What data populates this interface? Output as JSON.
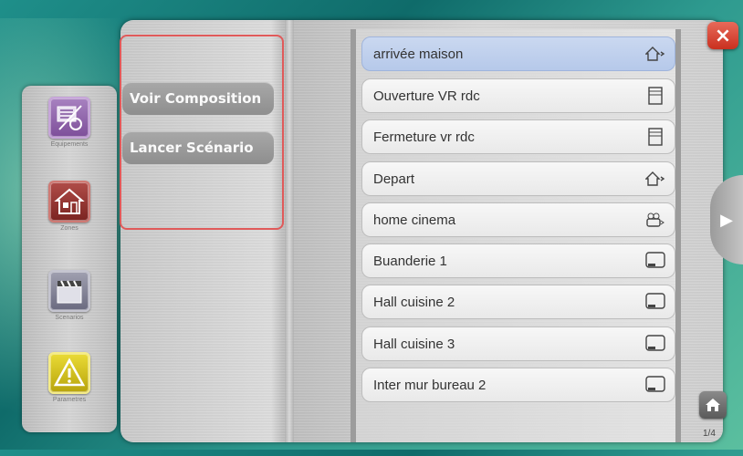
{
  "dock": {
    "items": [
      {
        "label": "Equipements",
        "icon": "equipment-icon"
      },
      {
        "label": "Zones",
        "icon": "house-icon"
      },
      {
        "label": "Scenarios",
        "icon": "clapperboard-icon"
      },
      {
        "label": "Parametres",
        "icon": "warning-icon"
      }
    ]
  },
  "menu": {
    "items": [
      {
        "label": "Voir Composition"
      },
      {
        "label": "Lancer Scénario"
      }
    ]
  },
  "scenarios": {
    "items": [
      {
        "label": "arrivée maison",
        "icon": "house-arrive-icon",
        "selected": true
      },
      {
        "label": "Ouverture VR rdc",
        "icon": "shutter-icon"
      },
      {
        "label": "Fermeture vr rdc",
        "icon": "shutter-icon"
      },
      {
        "label": "Depart",
        "icon": "house-leave-icon"
      },
      {
        "label": "home cinema",
        "icon": "projector-icon"
      },
      {
        "label": "Buanderie 1",
        "icon": "light-dimmer-icon"
      },
      {
        "label": "Hall cuisine 2",
        "icon": "light-dimmer-icon"
      },
      {
        "label": "Hall cuisine 3",
        "icon": "light-dimmer-icon"
      },
      {
        "label": "Inter mur bureau 2",
        "icon": "light-dimmer-icon"
      }
    ]
  },
  "close": {
    "label": "×"
  },
  "next": {
    "label": "▶"
  },
  "pager": {
    "text": "1/4"
  },
  "colors": {
    "selected_row": "#b6c9ea",
    "close": "#c9301f",
    "menu_border": "#e05a5a"
  }
}
